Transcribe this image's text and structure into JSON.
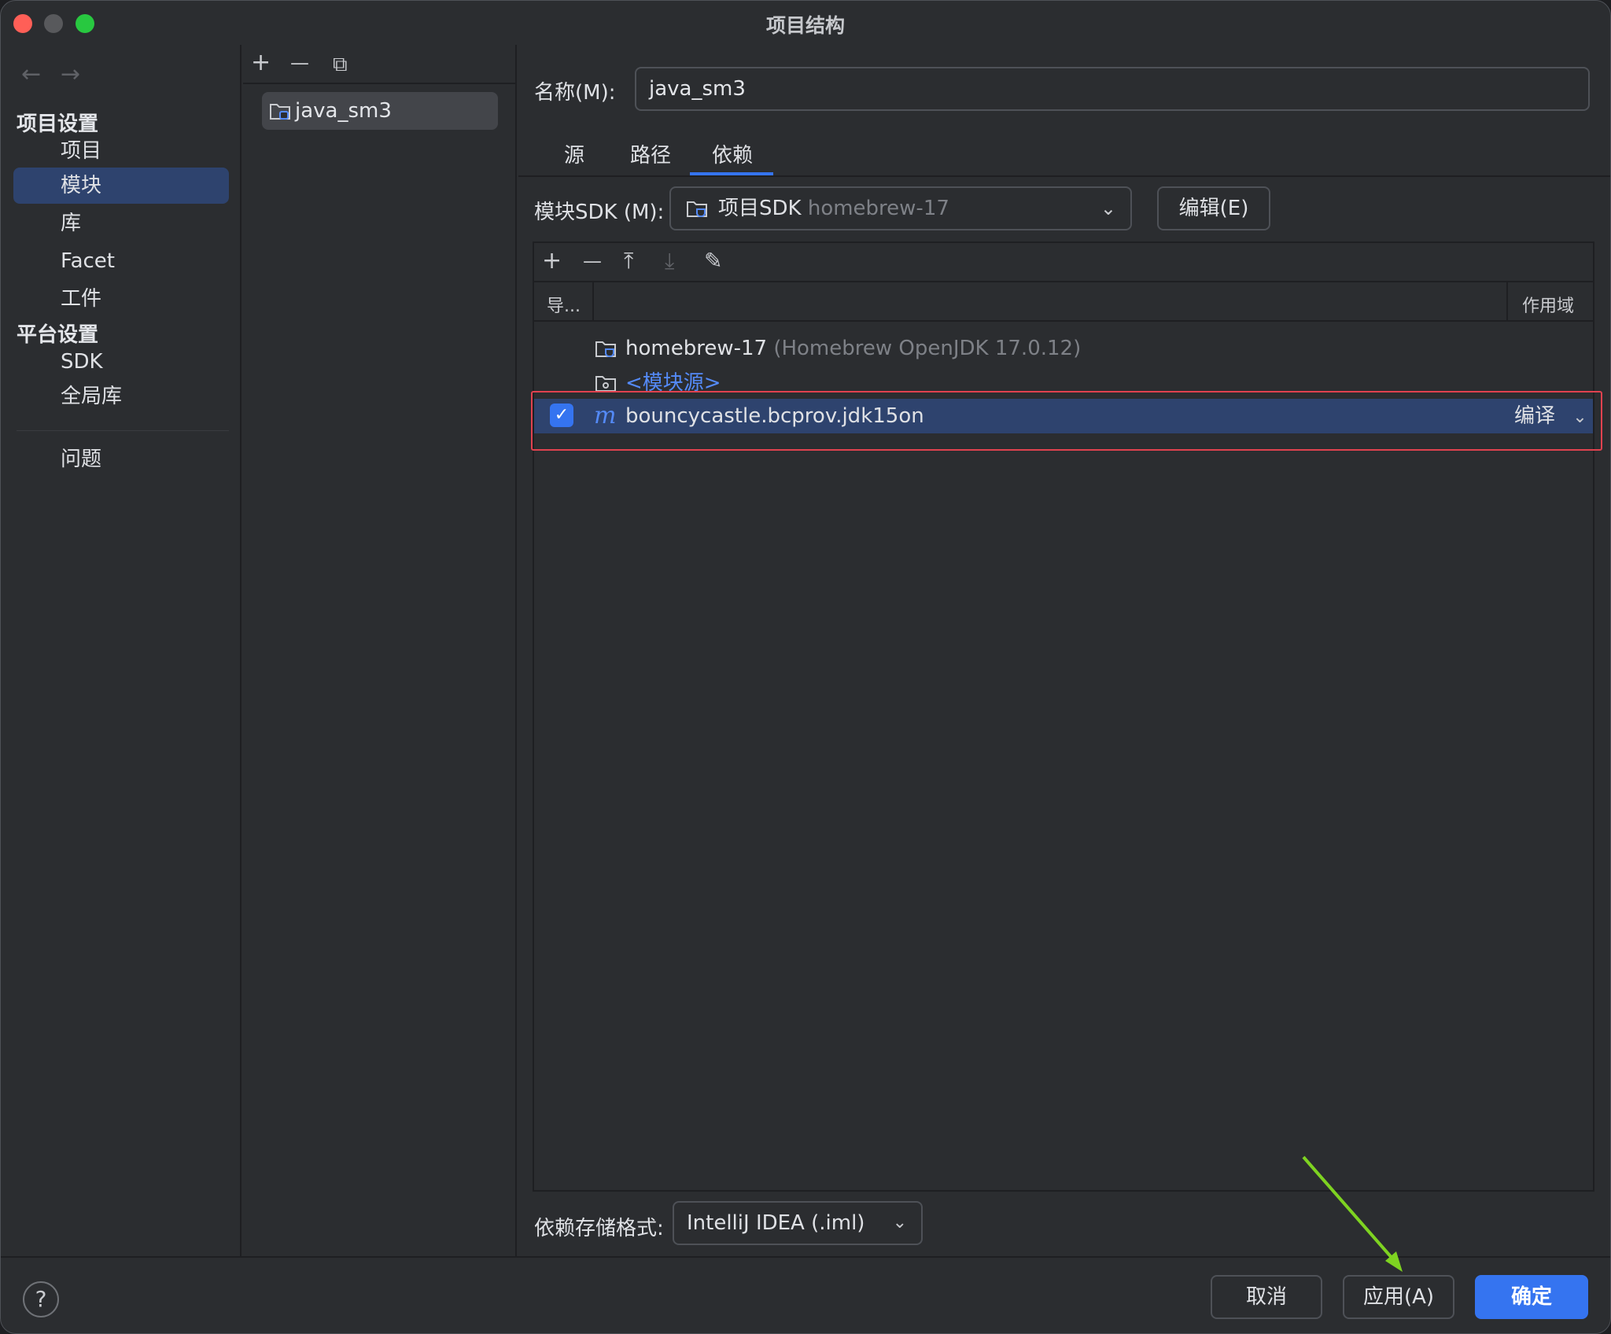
{
  "window": {
    "title": "项目结构"
  },
  "nav": {
    "back": "←",
    "forward": "→",
    "project_settings_header": "项目设置",
    "project_settings": [
      "项目",
      "模块",
      "库",
      "Facet",
      "工件"
    ],
    "platform_settings_header": "平台设置",
    "platform_settings": [
      "SDK",
      "全局库"
    ],
    "problems": "问题",
    "selected": "模块"
  },
  "modules": {
    "toolbar": {
      "add": "+",
      "remove": "—",
      "copy": "⧉"
    },
    "items": [
      "java_sm3"
    ]
  },
  "detail": {
    "name_label": "名称(M):",
    "name_value": "java_sm3",
    "tabs": [
      "源",
      "路径",
      "依赖"
    ],
    "active_tab": "依赖",
    "module_sdk_label": "模块SDK (M):",
    "module_sdk_value": "项目SDK",
    "module_sdk_hint": "homebrew-17",
    "edit_button": "编辑(E)",
    "dep_toolbar": {
      "add": "+",
      "remove": "—",
      "move_up": "⤒",
      "move_down": "⤓",
      "edit": "✎"
    },
    "columns": {
      "export": "导...",
      "scope": "作用域"
    },
    "dependencies": [
      {
        "name": "homebrew-17",
        "detail": "(Homebrew OpenJDK 17.0.12)"
      },
      {
        "name": "<模块源>"
      },
      {
        "name": "bouncycastle.bcprov.jdk15on",
        "checked": true,
        "scope": "编译",
        "icon_letter": "m"
      }
    ],
    "storage_format_label": "依赖存储格式:",
    "storage_format_value": "IntelliJ IDEA (.iml)"
  },
  "footer": {
    "help": "?",
    "cancel": "取消",
    "apply": "应用(A)",
    "ok": "确定"
  },
  "colors": {
    "accent": "#3574f0",
    "selection": "#2e436e",
    "highlight_box": "#e0424f",
    "annotation_arrow": "#7ed321"
  }
}
